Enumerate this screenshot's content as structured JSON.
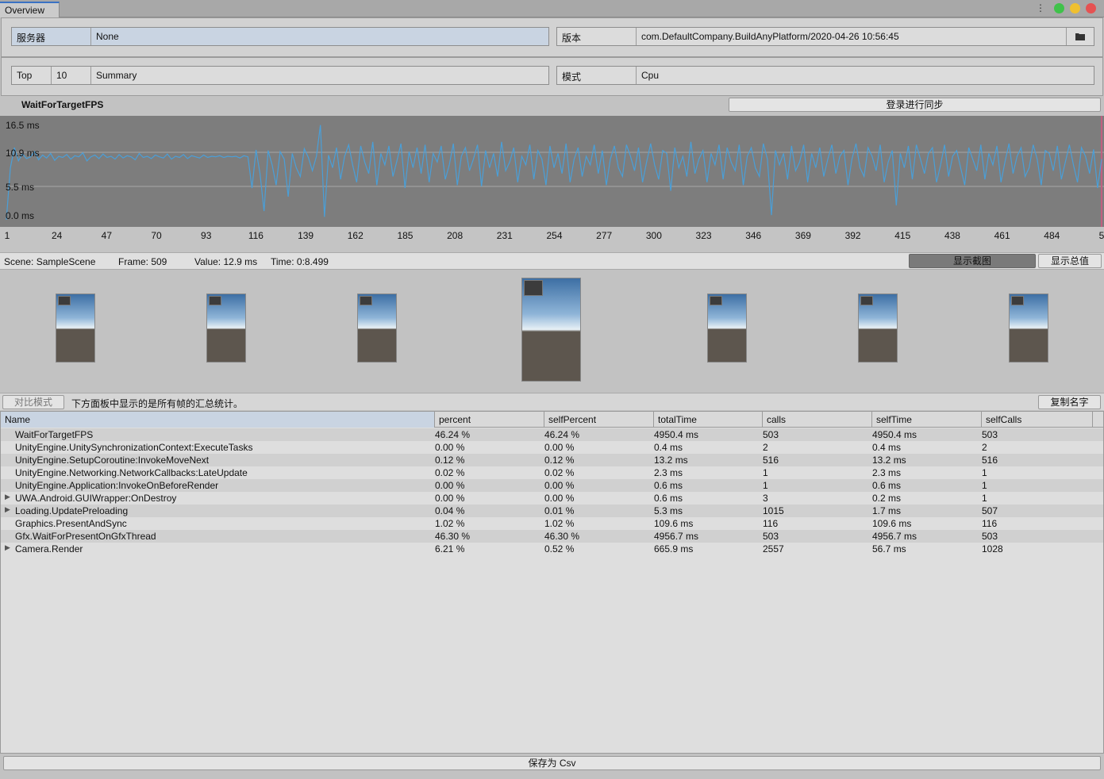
{
  "window": {
    "tab_label": "Overview"
  },
  "top": {
    "server_label": "服务器",
    "server_value": "None",
    "version_label": "版本",
    "version_value": "com.DefaultCompany.BuildAnyPlatform/2020-04-26 10:56:45",
    "top_label": "Top",
    "top_value": "10",
    "summary_value": "Summary",
    "mode_label": "模式",
    "mode_value": "Cpu"
  },
  "chart_header": {
    "title": "WaitForTargetFPS",
    "sync_button": "登录进行同步"
  },
  "chart_data": {
    "type": "line",
    "y_ticks": [
      "16.5 ms",
      "10.9 ms",
      "5.5 ms",
      "0.0 ms"
    ],
    "ylim": [
      0,
      16.5
    ],
    "x_ticks": [
      "1",
      "24",
      "47",
      "70",
      "93",
      "116",
      "139",
      "162",
      "185",
      "208",
      "231",
      "254",
      "277",
      "300",
      "323",
      "346",
      "369",
      "392",
      "415",
      "438",
      "461",
      "484",
      "5"
    ],
    "series": [
      {
        "color": "#4a9fd8",
        "y": [
          0.0,
          9.0,
          12.5,
          10.2,
          11.4,
          10.6,
          10.9,
          11.8,
          10.4,
          11.2,
          10.7,
          11.5,
          10.3,
          11.0,
          10.8,
          11.3,
          10.5,
          11.1,
          10.9,
          11.6,
          10.2,
          10.9,
          11.2,
          10.6,
          11.4,
          10.8,
          11.0,
          10.5,
          11.3,
          10.7,
          11.1,
          10.9,
          10.4,
          11.5,
          10.8,
          11.0,
          10.6,
          11.2,
          10.9,
          10.7,
          11.4,
          10.5,
          11.0,
          10.8,
          11.3,
          10.6,
          11.1,
          10.9,
          10.7,
          11.2,
          10.8,
          11.0,
          10.9,
          11.1,
          10.8,
          11.0,
          10.9,
          11.0,
          10.7,
          11.1,
          10.9,
          5.5,
          12.1,
          8.0,
          1.5,
          12.0,
          9.5,
          6.0,
          11.8,
          10.5,
          4.0,
          11.5,
          9.0,
          7.5,
          12.3,
          10.8,
          8.5,
          11.0,
          16.4,
          0.5,
          11.2,
          9.0,
          12.5,
          7.0,
          11.0,
          13.0,
          9.5,
          6.5,
          12.8,
          10.0,
          8.0,
          13.5,
          6.0,
          11.5,
          9.5,
          12.8,
          7.5,
          10.2,
          13.2,
          5.5,
          11.8,
          9.0,
          12.5,
          8.0,
          13.0,
          6.5,
          11.5,
          10.0,
          12.8,
          7.0,
          9.5,
          13.2,
          6.0,
          11.0,
          12.5,
          8.5,
          10.5,
          13.0,
          5.8,
          12.0,
          9.0,
          11.5,
          7.5,
          13.5,
          8.5,
          10.0,
          12.5,
          6.5,
          11.0,
          9.5,
          13.0,
          7.0,
          12.0,
          10.5,
          6.0,
          12.8,
          9.0,
          11.5,
          8.0,
          13.2,
          6.5,
          10.5,
          12.5,
          7.5,
          11.0,
          9.5,
          13.0,
          8.0,
          12.0,
          6.0,
          10.5,
          12.8,
          9.0,
          7.5,
          13.0,
          11.0,
          8.5,
          12.5,
          6.5,
          10.0,
          13.2,
          9.5,
          7.0,
          12.0,
          11.5,
          5.0,
          12.5,
          9.0,
          11.0,
          7.5,
          13.5,
          8.0,
          10.5,
          12.0,
          6.5,
          11.5,
          9.5,
          13.0,
          7.0,
          12.5,
          10.0,
          8.5,
          13.0,
          6.0,
          11.0,
          12.5,
          9.0,
          7.5,
          13.2,
          10.5,
          0.8,
          12.0,
          9.5,
          11.5,
          7.0,
          12.8,
          8.5,
          10.0,
          13.0,
          6.5,
          11.5,
          9.0,
          12.5,
          7.5,
          10.5,
          13.0,
          8.0,
          11.0,
          12.0,
          6.0,
          10.5,
          13.2,
          9.0,
          7.5,
          12.5,
          11.0,
          8.5,
          13.0,
          6.5,
          10.0,
          12.0,
          2.5,
          11.5,
          9.0,
          12.8,
          7.0,
          13.0,
          10.5,
          8.0,
          11.5,
          12.5,
          6.5,
          9.5,
          13.0,
          7.5,
          11.0,
          12.0,
          9.0,
          6.0,
          12.5,
          10.5,
          8.5,
          13.0,
          7.0,
          11.5,
          9.5,
          12.8,
          6.5,
          10.0,
          13.2,
          8.0,
          11.0,
          12.5,
          7.5,
          9.0,
          13.0,
          10.5,
          6.0,
          12.0,
          11.5,
          8.5,
          12.8,
          7.0,
          10.0,
          13.0,
          9.5,
          6.5,
          12.5,
          11.0,
          8.0,
          12.2,
          5.5,
          10.5
        ]
      }
    ]
  },
  "status": {
    "scene": "Scene: SampleScene",
    "frame": "Frame: 509",
    "value": "Value: 12.9 ms",
    "time": "Time: 0:8.499",
    "show_screenshot": "显示截图",
    "show_total": "显示总值"
  },
  "toolbar": {
    "compare_mode": "对比模式",
    "note": "下方面板中显示的是所有帧的汇总统计。",
    "copy_name": "复制名字"
  },
  "table": {
    "headers": [
      "Name",
      "percent",
      "selfPercent",
      "totalTime",
      "calls",
      "selfTime",
      "selfCalls"
    ],
    "rows": [
      {
        "name": "WaitForTargetFPS",
        "percent": "46.24 %",
        "selfPercent": "46.24 %",
        "totalTime": "4950.4 ms",
        "calls": "503",
        "selfTime": "4950.4 ms",
        "selfCalls": "503",
        "expandable": false
      },
      {
        "name": "UnityEngine.UnitySynchronizationContext:ExecuteTasks",
        "percent": "0.00 %",
        "selfPercent": "0.00 %",
        "totalTime": "0.4 ms",
        "calls": "2",
        "selfTime": "0.4 ms",
        "selfCalls": "2",
        "expandable": false
      },
      {
        "name": "UnityEngine.SetupCoroutine:InvokeMoveNext",
        "percent": "0.12 %",
        "selfPercent": "0.12 %",
        "totalTime": "13.2 ms",
        "calls": "516",
        "selfTime": "13.2 ms",
        "selfCalls": "516",
        "expandable": false
      },
      {
        "name": "UnityEngine.Networking.NetworkCallbacks:LateUpdate",
        "percent": "0.02 %",
        "selfPercent": "0.02 %",
        "totalTime": "2.3 ms",
        "calls": "1",
        "selfTime": "2.3 ms",
        "selfCalls": "1",
        "expandable": false
      },
      {
        "name": "UnityEngine.Application:InvokeOnBeforeRender",
        "percent": "0.00 %",
        "selfPercent": "0.00 %",
        "totalTime": "0.6 ms",
        "calls": "1",
        "selfTime": "0.6 ms",
        "selfCalls": "1",
        "expandable": false
      },
      {
        "name": "UWA.Android.GUIWrapper:OnDestroy",
        "percent": "0.00 %",
        "selfPercent": "0.00 %",
        "totalTime": "0.6 ms",
        "calls": "3",
        "selfTime": "0.2 ms",
        "selfCalls": "1",
        "expandable": true
      },
      {
        "name": "Loading.UpdatePreloading",
        "percent": "0.04 %",
        "selfPercent": "0.01 %",
        "totalTime": "5.3 ms",
        "calls": "1015",
        "selfTime": "1.7 ms",
        "selfCalls": "507",
        "expandable": true
      },
      {
        "name": "Graphics.PresentAndSync",
        "percent": "1.02 %",
        "selfPercent": "1.02 %",
        "totalTime": "109.6 ms",
        "calls": "116",
        "selfTime": "109.6 ms",
        "selfCalls": "116",
        "expandable": false
      },
      {
        "name": "Gfx.WaitForPresentOnGfxThread",
        "percent": "46.30 %",
        "selfPercent": "46.30 %",
        "totalTime": "4956.7 ms",
        "calls": "503",
        "selfTime": "4956.7 ms",
        "selfCalls": "503",
        "expandable": false
      },
      {
        "name": "Camera.Render",
        "percent": "6.21 %",
        "selfPercent": "0.52 %",
        "totalTime": "665.9 ms",
        "calls": "2557",
        "selfTime": "56.7 ms",
        "selfCalls": "1028",
        "expandable": true
      }
    ]
  },
  "footer": {
    "save_csv": "保存为 Csv"
  },
  "colors": {
    "accent": "#3a72c4",
    "line": "#4a9fd8",
    "chart_bg": "#7d7d7d",
    "selected": "#c9d4e2"
  }
}
